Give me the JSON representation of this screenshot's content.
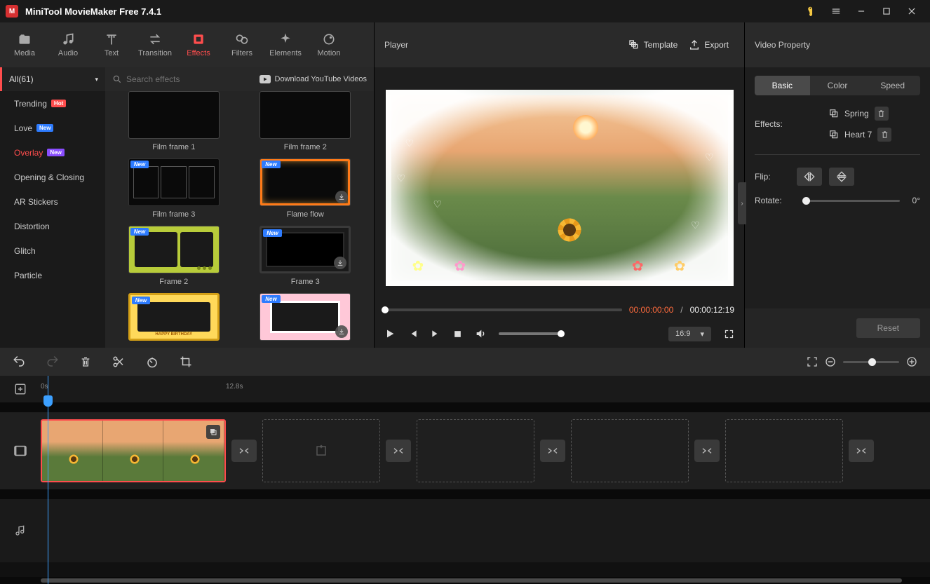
{
  "app": {
    "title": "MiniTool MovieMaker Free 7.4.1"
  },
  "toolbar": {
    "items": [
      {
        "label": "Media",
        "icon": "folder"
      },
      {
        "label": "Audio",
        "icon": "music"
      },
      {
        "label": "Text",
        "icon": "text"
      },
      {
        "label": "Transition",
        "icon": "swap"
      },
      {
        "label": "Effects",
        "icon": "square",
        "active": true
      },
      {
        "label": "Filters",
        "icon": "circles"
      },
      {
        "label": "Elements",
        "icon": "sparkle"
      },
      {
        "label": "Motion",
        "icon": "ball"
      }
    ]
  },
  "sidebar": {
    "header": "All(61)",
    "items": [
      {
        "label": "Trending",
        "badge": "Hot",
        "badgeClass": "hot"
      },
      {
        "label": "Love",
        "badge": "New",
        "badgeClass": "new"
      },
      {
        "label": "Overlay",
        "badge": "New",
        "badgeClass": "new2",
        "active": true
      },
      {
        "label": "Opening & Closing"
      },
      {
        "label": "AR Stickers"
      },
      {
        "label": "Distortion"
      },
      {
        "label": "Glitch"
      },
      {
        "label": "Particle"
      }
    ]
  },
  "search": {
    "placeholder": "Search effects"
  },
  "ytLink": "Download YouTube Videos",
  "effects": [
    {
      "label": "Film frame 1",
      "new": false,
      "dl": false,
      "style": "film1"
    },
    {
      "label": "Film frame 2",
      "new": false,
      "dl": false,
      "style": "film2"
    },
    {
      "label": "Film frame 3",
      "new": true,
      "dl": false,
      "style": "film3"
    },
    {
      "label": "Flame flow",
      "new": true,
      "dl": true,
      "style": "flame"
    },
    {
      "label": "Frame 2",
      "new": true,
      "dl": false,
      "style": "frame2"
    },
    {
      "label": "Frame 3",
      "new": true,
      "dl": true,
      "style": "frame3"
    },
    {
      "label": "",
      "new": true,
      "dl": false,
      "style": "birthday"
    },
    {
      "label": "",
      "new": true,
      "dl": true,
      "style": "pink"
    }
  ],
  "player": {
    "title": "Player",
    "template": "Template",
    "export": "Export",
    "currentTime": "00:00:00:00",
    "totalTime": "00:00:12:19",
    "ratio": "16:9"
  },
  "property": {
    "title": "Video Property",
    "tabs": [
      "Basic",
      "Color",
      "Speed"
    ],
    "activeTab": 0,
    "effectsLabel": "Effects:",
    "appliedEffects": [
      "Spring",
      "Heart 7"
    ],
    "flipLabel": "Flip:",
    "rotateLabel": "Rotate:",
    "rotateValue": "0°",
    "reset": "Reset"
  },
  "timeline": {
    "marks": [
      {
        "label": "0s",
        "pos": 0
      },
      {
        "label": "12.8s",
        "pos": 264
      }
    ]
  }
}
